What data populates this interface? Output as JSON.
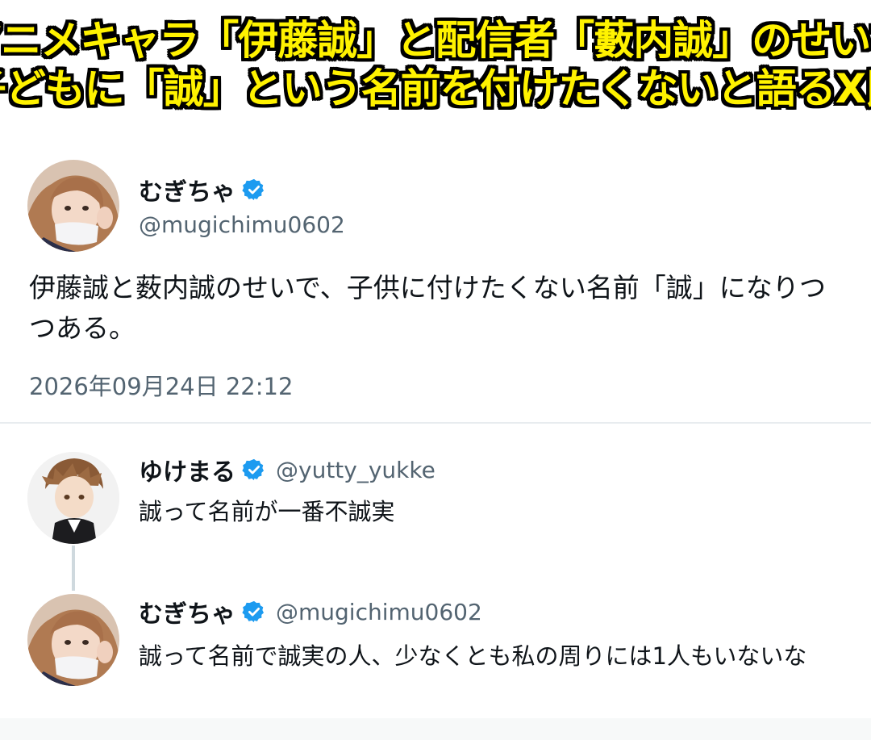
{
  "banner": {
    "line1": "アニメキャラ「伊藤誠」と配信者「藪内誠」のせいで",
    "line2": "子どもに「誠」という名前を付けたくないと語るX民",
    "text_color": "#fff200",
    "outline_color": "#000000"
  },
  "main_tweet": {
    "display_name": "むぎちゃ",
    "handle": "@mugichimu0602",
    "text": "伊藤誠と薮内誠のせいで、子供に付けたくない名前「誠」になりつつある。",
    "timestamp": "2026年09月24日 22:12",
    "verified_icon": "verified-badge-icon"
  },
  "replies": [
    {
      "display_name": "ゆけまる",
      "handle": "@yutty_yukke",
      "text": "誠って名前が一番不誠実",
      "verified_icon": "verified-badge-icon"
    },
    {
      "display_name": "むぎちゃ",
      "handle": "@mugichimu0602",
      "text": "誠って名前で誠実の人、少なくとも私の周りには1人もいないな",
      "verified_icon": "verified-badge-icon"
    }
  ],
  "colors": {
    "verified": "#1d9bf0",
    "secondary_text": "#536471",
    "primary_text": "#0f1419",
    "thread_line": "#cfd9de"
  }
}
